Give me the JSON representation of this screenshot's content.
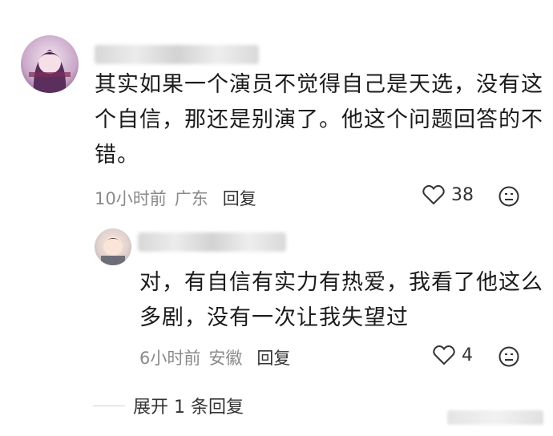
{
  "comment": {
    "text_line1": "其实如果一个演员不觉得自己是天选，没有这",
    "text_line2": "个自信，那还是别演了。他这个问题回答的不",
    "text_line3": "错。",
    "time": "10小时前",
    "location": "广东",
    "reply_label": "回复",
    "likes": "38"
  },
  "reply": {
    "text_line1": "对，有自信有实力有热爱，我看了他这么",
    "text_line2": "多剧，没有一次让我失望过",
    "time": "6小时前",
    "location": "安徽",
    "reply_label": "回复",
    "likes": "4"
  },
  "expand_label": "展开 1 条回复",
  "icons": [
    "heart-icon",
    "emoji-dislike-icon"
  ]
}
